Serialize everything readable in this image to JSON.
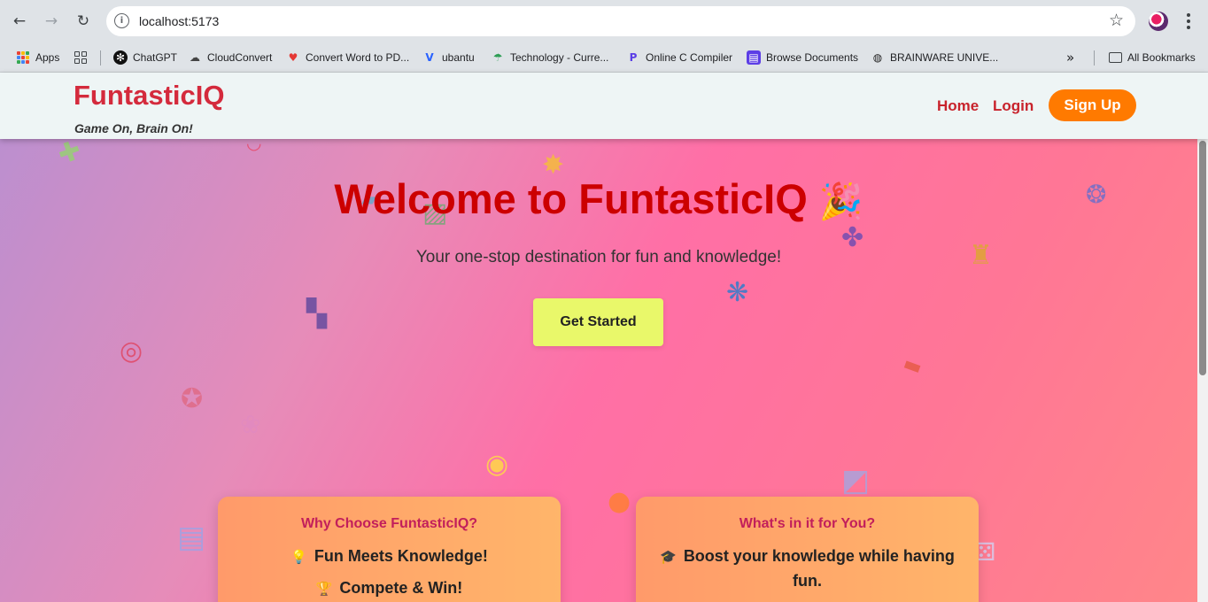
{
  "browser": {
    "url": "localhost:5173",
    "icons": {
      "back": "back-arrow-icon",
      "forward": "forward-arrow-icon",
      "reload": "reload-icon",
      "info": "site-info-icon",
      "star": "bookmark-star-icon",
      "menu": "kebab-menu-icon"
    },
    "bookmarks": [
      {
        "label": "Apps",
        "icon": "apps-grid-icon"
      },
      {
        "label": "ChatGPT",
        "icon": "chatgpt-icon"
      },
      {
        "label": "CloudConvert",
        "icon": "cloud-icon"
      },
      {
        "label": "Convert Word to PD...",
        "icon": "heart-icon"
      },
      {
        "label": "ubantu",
        "icon": "v-logo-icon"
      },
      {
        "label": "Technology - Curre...",
        "icon": "umbrella-icon"
      },
      {
        "label": "Online C Compiler",
        "icon": "compiler-icon"
      },
      {
        "label": "Browse Documents",
        "icon": "documents-icon"
      },
      {
        "label": "BRAINWARE UNIVE...",
        "icon": "globe-icon"
      }
    ],
    "all_bookmarks": "All Bookmarks"
  },
  "site": {
    "brand": "FuntasticIQ",
    "tagline": "Game On, Brain On!",
    "nav": {
      "home": "Home",
      "login": "Login",
      "signup": "Sign Up"
    },
    "colors": {
      "brand": "#d42a3c",
      "signup_bg": "#ff7a00",
      "cta_bg": "#e9f86a",
      "title": "#cc0000"
    }
  },
  "hero": {
    "title": "Welcome to FuntasticIQ",
    "title_emoji": "🎉",
    "subtitle": "Your one-stop destination for fun and knowledge!",
    "cta": "Get Started"
  },
  "cards": [
    {
      "title": "Why Choose FuntasticIQ?",
      "lines": [
        {
          "emoji": "💡",
          "text": "Fun Meets Knowledge!"
        },
        {
          "emoji": "🏆",
          "text": "Compete & Win!"
        }
      ]
    },
    {
      "title": "What's in it for You?",
      "lines": [
        {
          "emoji": "🎓",
          "text": "Boost your knowledge while having fun."
        }
      ]
    }
  ],
  "floating_icons": [
    "puzzle-icon",
    "star-icon",
    "target-icon",
    "trophy-icon",
    "controller-icon",
    "medal-icon",
    "lightbulb-icon",
    "chart-icon",
    "balloon-icon",
    "dice-icon",
    "pencil-icon",
    "abacus-icon",
    "confetti-icon",
    "brain-icon",
    "books-icon"
  ]
}
